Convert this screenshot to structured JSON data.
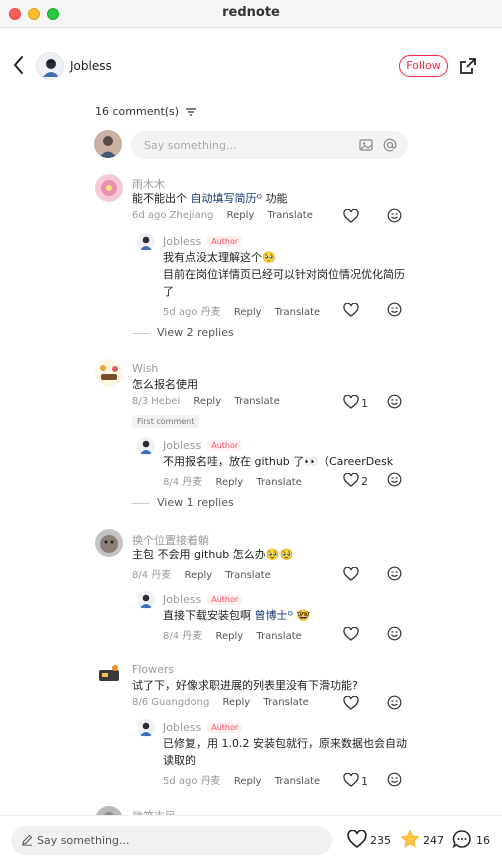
{
  "window": {
    "title": "rednote"
  },
  "header": {
    "author_name": "Jobless",
    "follow_label": "Follow"
  },
  "comments_header": {
    "count_label": "16 comment(s)"
  },
  "input_top": {
    "placeholder": "Say something..."
  },
  "comments": [
    {
      "user": "雨木木",
      "text_before": "能不能出个 ",
      "link": "自动填写简历",
      "link_mark": "ᴼ",
      "text_after": " 功能",
      "date": "6d ago",
      "location": "Zhejiang",
      "reply": "Reply",
      "translate": "Translate",
      "likes": "",
      "reply_item": {
        "user": "Jobless",
        "tag": "Author",
        "line1": "我有点没太理解这个🥺",
        "line2": "目前在岗位详情页已经可以针对岗位情况优化简历",
        "line3": "了",
        "date": "5d ago",
        "location": "丹麦",
        "reply": "Reply",
        "translate": "Translate",
        "likes": ""
      },
      "view_replies": "View 2 replies"
    },
    {
      "user": "Wish",
      "text": "怎么报名使用",
      "date": "8/3",
      "location": "Hebei",
      "reply": "Reply",
      "translate": "Translate",
      "likes": "1",
      "badge": "First comment",
      "reply_item": {
        "user": "Jobless",
        "tag": "Author",
        "line1": "不用报名哇，放在 github 了👀（CareerDesk",
        "date": "8/4",
        "location": "丹麦",
        "reply": "Reply",
        "translate": "Translate",
        "likes": "2"
      },
      "view_replies": "View 1 replies"
    },
    {
      "user": "换个位置接着躺",
      "text": "主包 不会用 github 怎么办🥹🥹",
      "date": "8/4",
      "location": "丹麦",
      "reply": "Reply",
      "translate": "Translate",
      "likes": "",
      "reply_item": {
        "user": "Jobless",
        "tag": "Author",
        "line1_before": "直接下载安装包啊 ",
        "link": "曾博士",
        "link_mark": "ᴼ",
        "line1_after": " 🤓",
        "date": "8/4",
        "location": "丹麦",
        "reply": "Reply",
        "translate": "Translate",
        "likes": ""
      }
    },
    {
      "user": "Flowers",
      "text": "试了下，好像求职进展的列表里没有下滑功能?",
      "date": "8/6",
      "location": "Guangdong",
      "reply": "Reply",
      "translate": "Translate",
      "likes": "",
      "reply_item": {
        "user": "Jobless",
        "tag": "Author",
        "line1": "已修复，用 1.0.2 安装包就行，原来数据也会自动",
        "line2": "读取的",
        "date": "5d ago",
        "location": "丹麦",
        "reply": "Reply",
        "translate": "Translate",
        "likes": "1"
      }
    },
    {
      "user": "微笑市民"
    }
  ],
  "bottom_bar": {
    "placeholder": "Say something...",
    "likes": "235",
    "stars": "247",
    "comments": "16"
  },
  "colors": {
    "accent": "#ff2442",
    "link": "#13386c",
    "star": "#ffc53d"
  }
}
